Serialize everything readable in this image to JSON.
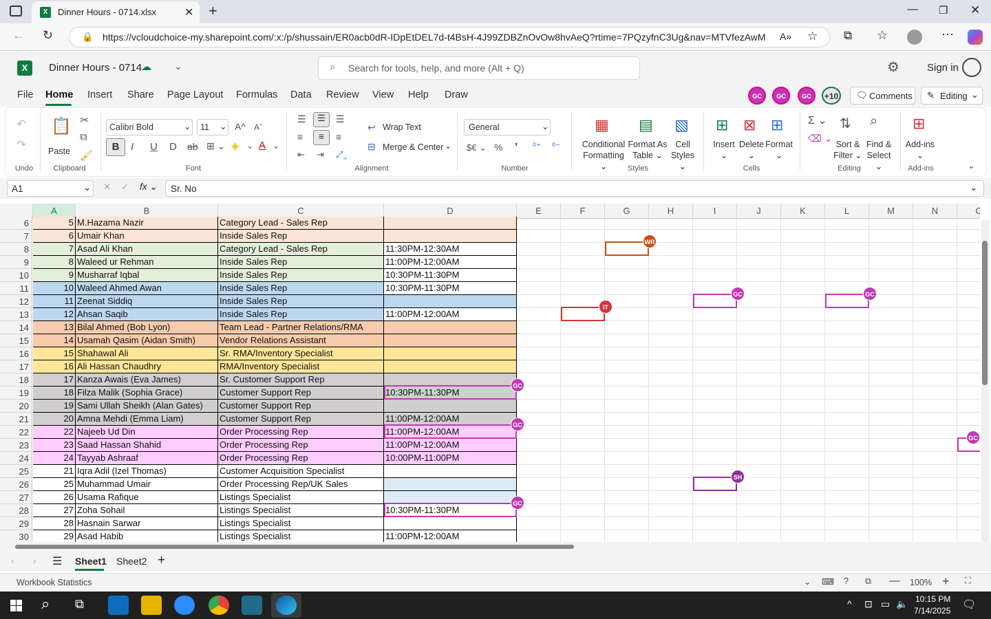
{
  "browser": {
    "tab_title": "Dinner Hours - 0714.xlsx",
    "url": "https://vcloudchoice-my.sharepoint.com/:x:/p/shussain/ER0acb0dR-IDpEtDEL7d-t4BsH-4J99ZDBZnOvOw8hvAeQ?rtime=7PQzyfnC3Ug&nav=MTVfezAwM..."
  },
  "app": {
    "file_name": "Dinner Hours - 0714",
    "search_placeholder": "Search for tools, help, and more (Alt + Q)",
    "sign_in": "Sign in"
  },
  "menu": [
    "File",
    "Home",
    "Insert",
    "Share",
    "Page Layout",
    "Formulas",
    "Data",
    "Review",
    "View",
    "Help",
    "Draw"
  ],
  "collab": {
    "avatar1": "GC",
    "avatar2": "GC",
    "avatar3": "GC",
    "more": "+10",
    "comments": "Comments",
    "editing": "Editing"
  },
  "ribbon": {
    "undo": "Undo",
    "paste": "Paste",
    "clipboard": "Clipboard",
    "font_name": "Calibri Bold",
    "font_size": "11",
    "font": "Font",
    "wrap": "Wrap Text",
    "merge": "Merge & Center",
    "alignment": "Alignment",
    "number_format": "General",
    "number": "Number",
    "cond1": "Conditional",
    "cond2": "Formatting",
    "fat1": "Format As",
    "fat2": "Table",
    "cs1": "Cell",
    "cs2": "Styles",
    "styles": "Styles",
    "insert": "Insert",
    "delete": "Delete",
    "format": "Format",
    "cells": "Cells",
    "sort1": "Sort &",
    "sort2": "Filter",
    "find1": "Find &",
    "find2": "Select",
    "editing": "Editing",
    "addins": "Add-ins",
    "addins_grp": "Add-ins"
  },
  "formula_bar": {
    "name_box": "A1",
    "content": "Sr. No"
  },
  "columns": [
    "A",
    "B",
    "C",
    "D",
    "E",
    "F",
    "G",
    "H",
    "I",
    "J",
    "K",
    "L",
    "M",
    "N",
    "O"
  ],
  "rows": [
    {
      "r": "6",
      "a": "5",
      "b": "M.Hazama Nazir",
      "c": "Category Lead - Sales Rep",
      "d": ""
    },
    {
      "r": "7",
      "a": "6",
      "b": "Umair Khan",
      "c": "Inside Sales Rep",
      "d": ""
    },
    {
      "r": "8",
      "a": "7",
      "b": "Asad Ali Khan",
      "c": "Category Lead - Sales Rep",
      "d": "11:30PM-12:30AM"
    },
    {
      "r": "9",
      "a": "8",
      "b": "Waleed ur Rehman",
      "c": "Inside Sales Rep",
      "d": "11:00PM-12:00AM"
    },
    {
      "r": "10",
      "a": "9",
      "b": "Musharraf Iqbal",
      "c": "Inside Sales Rep",
      "d": "10:30PM-11:30PM"
    },
    {
      "r": "11",
      "a": "10",
      "b": "Waleed Ahmed Awan",
      "c": "Inside Sales Rep",
      "d": "10:30PM-11:30PM"
    },
    {
      "r": "12",
      "a": "11",
      "b": "Zeenat Siddiq",
      "c": "Inside Sales Rep",
      "d": ""
    },
    {
      "r": "13",
      "a": "12",
      "b": "Ahsan Saqib",
      "c": "Inside Sales Rep",
      "d": "11:00PM-12:00AM"
    },
    {
      "r": "14",
      "a": "13",
      "b": "Bilal Ahmed (Bob Lyon)",
      "c": "Team Lead - Partner Relations/RMA",
      "d": ""
    },
    {
      "r": "15",
      "a": "14",
      "b": "Usamah Qasim (Aidan Smith)",
      "c": "Vendor Relations Assistant",
      "d": ""
    },
    {
      "r": "16",
      "a": "15",
      "b": "Shahawal Ali",
      "c": "Sr. RMA/Inventory Specialist",
      "d": ""
    },
    {
      "r": "17",
      "a": "16",
      "b": "Ali Hassan Chaudhry",
      "c": "RMA/Inventory Specialist",
      "d": ""
    },
    {
      "r": "18",
      "a": "17",
      "b": "Kanza Awais (Eva James)",
      "c": "Sr. Customer Support Rep",
      "d": ""
    },
    {
      "r": "19",
      "a": "18",
      "b": "Filza Malik (Sophia Grace)",
      "c": "Customer Support Rep",
      "d": "10:30PM-11:30PM"
    },
    {
      "r": "20",
      "a": "19",
      "b": "Sami Ullah Sheikh (Alan Gates)",
      "c": "Customer Support Rep",
      "d": ""
    },
    {
      "r": "21",
      "a": "20",
      "b": "Amna Mehdi (Emma Liam)",
      "c": "Customer Support Rep",
      "d": "11:00PM-12:00AM"
    },
    {
      "r": "22",
      "a": "22",
      "b": "Najeeb Ud Din",
      "c": "Order Processing Rep",
      "d": "11:00PM-12:00AM"
    },
    {
      "r": "23",
      "a": "23",
      "b": "Saad Hassan Shahid",
      "c": "Order Processing Rep",
      "d": "11:00PM-12:00AM"
    },
    {
      "r": "24",
      "a": "24",
      "b": "Tayyab Ashraaf",
      "c": "Order Processing Rep",
      "d": "10:00PM-11:00PM"
    },
    {
      "r": "25",
      "a": "21",
      "b": "Iqra Adil (Izel Thomas)",
      "c": "Customer Acquisition Specialist",
      "d": ""
    },
    {
      "r": "26",
      "a": "25",
      "b": "Muhammad Umair",
      "c": "Order Processing Rep/UK Sales",
      "d": ""
    },
    {
      "r": "27",
      "a": "26",
      "b": "Usama Rafique",
      "c": "Listings Specialist",
      "d": ""
    },
    {
      "r": "28",
      "a": "27",
      "b": "Zoha Sohail",
      "c": "Listings Specialist",
      "d": "10:30PM-11:30PM"
    },
    {
      "r": "29",
      "a": "28",
      "b": "Hasnain Sarwar",
      "c": "Listings Specialist",
      "d": ""
    },
    {
      "r": "30",
      "a": "29",
      "b": "Asad Habib",
      "c": "Listings Specialist",
      "d": "11:00PM-12:00AM"
    }
  ],
  "row_colors": [
    "#fbe5d6",
    "#fbe5d6",
    "#e2efda",
    "#e2efda",
    "#e2efda",
    "#bdd7ee",
    "#bdd7ee",
    "#bdd7ee",
    "#f8cbad",
    "#f8cbad",
    "#ffe699",
    "#ffe699",
    "#d0cece",
    "#d0cece",
    "#d0cece",
    "#d0cece",
    "#ffccff",
    "#ffccff",
    "#ffccff",
    "#ffffff",
    "#ffffff",
    "#ffffff",
    "#ffffff",
    "#ffffff",
    "#ffffff"
  ],
  "d_colors": {
    "r6": "#fbe5d6",
    "r26": "#ddebf7",
    "r27": "#ddebf7"
  },
  "presence": {
    "wr": "WR",
    "it": "IT",
    "gc": "GC",
    "sh": "SH"
  },
  "sheets": [
    "Sheet1",
    "Sheet2"
  ],
  "status": {
    "left": "Workbook Statistics",
    "zoom": "100%"
  },
  "taskbar": {
    "time": "10:15 PM",
    "date": "7/14/2025"
  },
  "colors": {
    "excel_green": "#107c41",
    "gc": "#c239b3",
    "wr": "#ca5010",
    "it": "#d13438",
    "sh": "#8b2f9a"
  }
}
